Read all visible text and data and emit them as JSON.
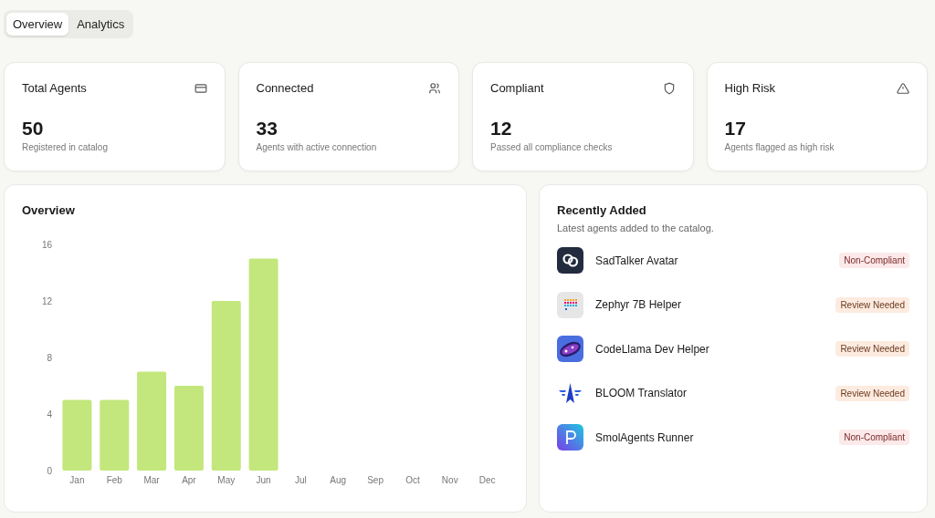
{
  "tabs": [
    {
      "label": "Overview",
      "selected": true
    },
    {
      "label": "Analytics",
      "selected": false
    }
  ],
  "stats": [
    {
      "title": "Total Agents",
      "value": "50",
      "caption": "Registered in catalog"
    },
    {
      "title": "Connected",
      "value": "33",
      "caption": "Agents with active connection"
    },
    {
      "title": "Compliant",
      "value": "12",
      "caption": "Passed all compliance checks"
    },
    {
      "title": "High Risk",
      "value": "17",
      "caption": "Agents flagged as high risk"
    }
  ],
  "overview": {
    "title": "Overview",
    "chart_data": {
      "type": "bar",
      "categories": [
        "Jan",
        "Feb",
        "Mar",
        "Apr",
        "May",
        "Jun",
        "Jul",
        "Aug",
        "Sep",
        "Oct",
        "Nov",
        "Dec"
      ],
      "values": [
        5,
        5,
        7,
        6,
        12,
        15,
        null,
        null,
        null,
        null,
        null,
        null
      ],
      "ylim": [
        0,
        16
      ],
      "yticks": [
        0,
        4,
        8,
        12,
        16
      ]
    }
  },
  "recent": {
    "title": "Recently Added",
    "subtitle": "Latest agents added to the catalog.",
    "items": [
      {
        "name": "SadTalker Avatar",
        "status": "Non-Compliant",
        "kind": "non_compliant"
      },
      {
        "name": "Zephyr 7B Helper",
        "status": "Review Needed",
        "kind": "review"
      },
      {
        "name": "CodeLlama Dev Helper",
        "status": "Review Needed",
        "kind": "review"
      },
      {
        "name": "BLOOM Translator",
        "status": "Review Needed",
        "kind": "review"
      },
      {
        "name": "SmolAgents Runner",
        "status": "Non-Compliant",
        "kind": "non_compliant"
      }
    ]
  }
}
